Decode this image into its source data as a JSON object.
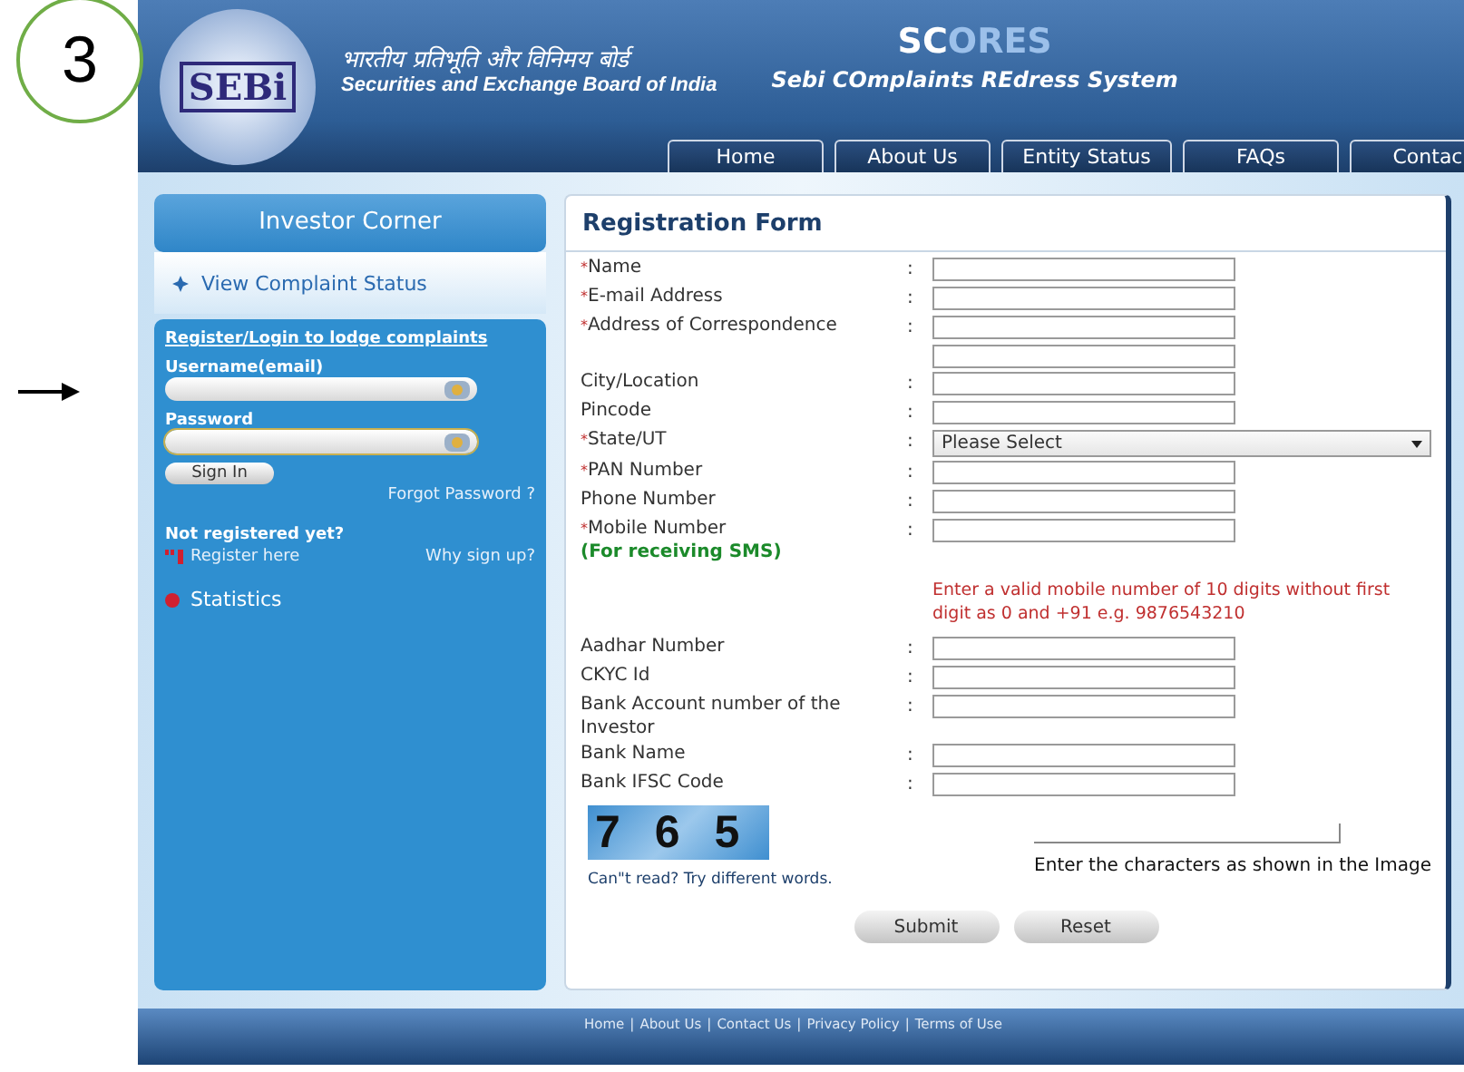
{
  "annotation": {
    "step": "3"
  },
  "header": {
    "logo": "SEBi",
    "hindi_title": "भारतीय प्रतिभूति और विनिमय बोर्ड",
    "english_title": "Securities and Exchange Board of India",
    "brand_lead": "SC",
    "brand_rest": "ORES",
    "tagline": "Sebi COmplaints REdress System"
  },
  "nav": [
    {
      "label": "Home"
    },
    {
      "label": "About Us"
    },
    {
      "label": "Entity Status"
    },
    {
      "label": "FAQs"
    },
    {
      "label": "Contac"
    }
  ],
  "sidebar": {
    "heading": "Investor Corner",
    "status_link": "View Complaint Status",
    "login": {
      "title": "Register/Login to lodge complaints",
      "username_label": "Username(email)",
      "password_label": "Password",
      "sign_in": "Sign In",
      "forgot": "Forgot Password ?",
      "not_registered": "Not registered yet?",
      "register": "Register here",
      "why": "Why sign up?"
    },
    "statistics": "Statistics"
  },
  "form": {
    "title": "Registration Form",
    "fields": [
      {
        "label": "Name",
        "required": true,
        "kind": "text"
      },
      {
        "label": "E-mail Address",
        "required": true,
        "kind": "text"
      },
      {
        "label": "Address of Correspondence",
        "required": true,
        "kind": "two_lines"
      },
      {
        "label": "City/Location",
        "required": false,
        "kind": "text"
      },
      {
        "label": "Pincode",
        "required": false,
        "kind": "text"
      },
      {
        "label": "State/UT",
        "required": true,
        "kind": "select",
        "value": "Please Select"
      },
      {
        "label": "PAN Number",
        "required": true,
        "kind": "text"
      },
      {
        "label": "Phone Number",
        "required": false,
        "kind": "text"
      },
      {
        "label": "Mobile Number",
        "required": true,
        "kind": "text",
        "note": "(For receiving SMS)",
        "hint": "Enter a valid mobile number of 10 digits without first digit as 0 and +91 e.g. 9876543210"
      },
      {
        "label": "Aadhar Number",
        "required": false,
        "kind": "text"
      },
      {
        "label": "CKYC Id",
        "required": false,
        "kind": "text"
      },
      {
        "label": "Bank Account number of the Investor",
        "required": false,
        "kind": "text"
      },
      {
        "label": "Bank Name",
        "required": false,
        "kind": "text"
      },
      {
        "label": "Bank IFSC Code",
        "required": false,
        "kind": "text"
      }
    ],
    "required_mark": "*",
    "separator": ":",
    "captcha": {
      "code": "7 6 5",
      "refresh": "Can\"t read? Try different words.",
      "instruction": "Enter the characters as shown in the Image"
    },
    "buttons": [
      "Submit",
      "Reset"
    ]
  },
  "footer": {
    "separator": "|",
    "links": [
      "Home",
      "About Us",
      "Contact Us",
      "Privacy Policy",
      "Terms of Use"
    ]
  }
}
